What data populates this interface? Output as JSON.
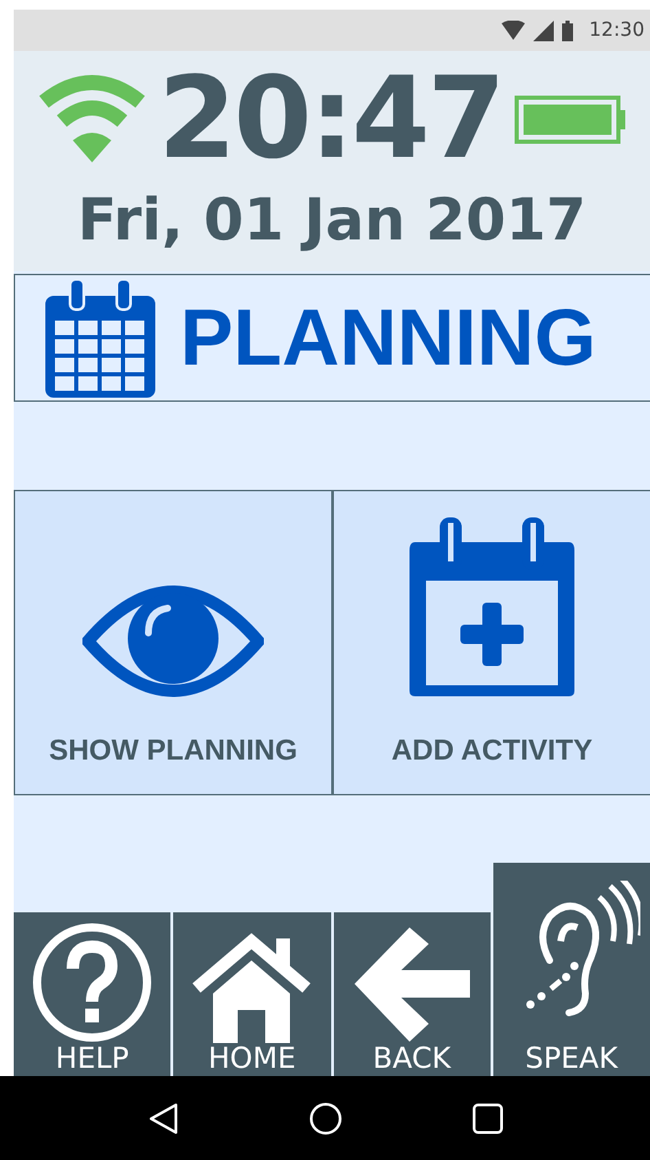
{
  "status_bar": {
    "time": "12:30"
  },
  "header": {
    "time": "20:47",
    "date": "Fri, 01 Jan 2017"
  },
  "page_title": "PLANNING",
  "tiles": [
    {
      "kind": "view",
      "label": "SHOW PLANNING"
    },
    {
      "kind": "add",
      "label": "ADD ACTIVITY"
    }
  ],
  "bottom_buttons": [
    {
      "kind": "help",
      "label": "HELP",
      "selected": false
    },
    {
      "kind": "home",
      "label": "HOME",
      "selected": false
    },
    {
      "kind": "back",
      "label": "BACK",
      "selected": false
    },
    {
      "kind": "speak",
      "label": "SPEAK",
      "selected": true
    }
  ]
}
